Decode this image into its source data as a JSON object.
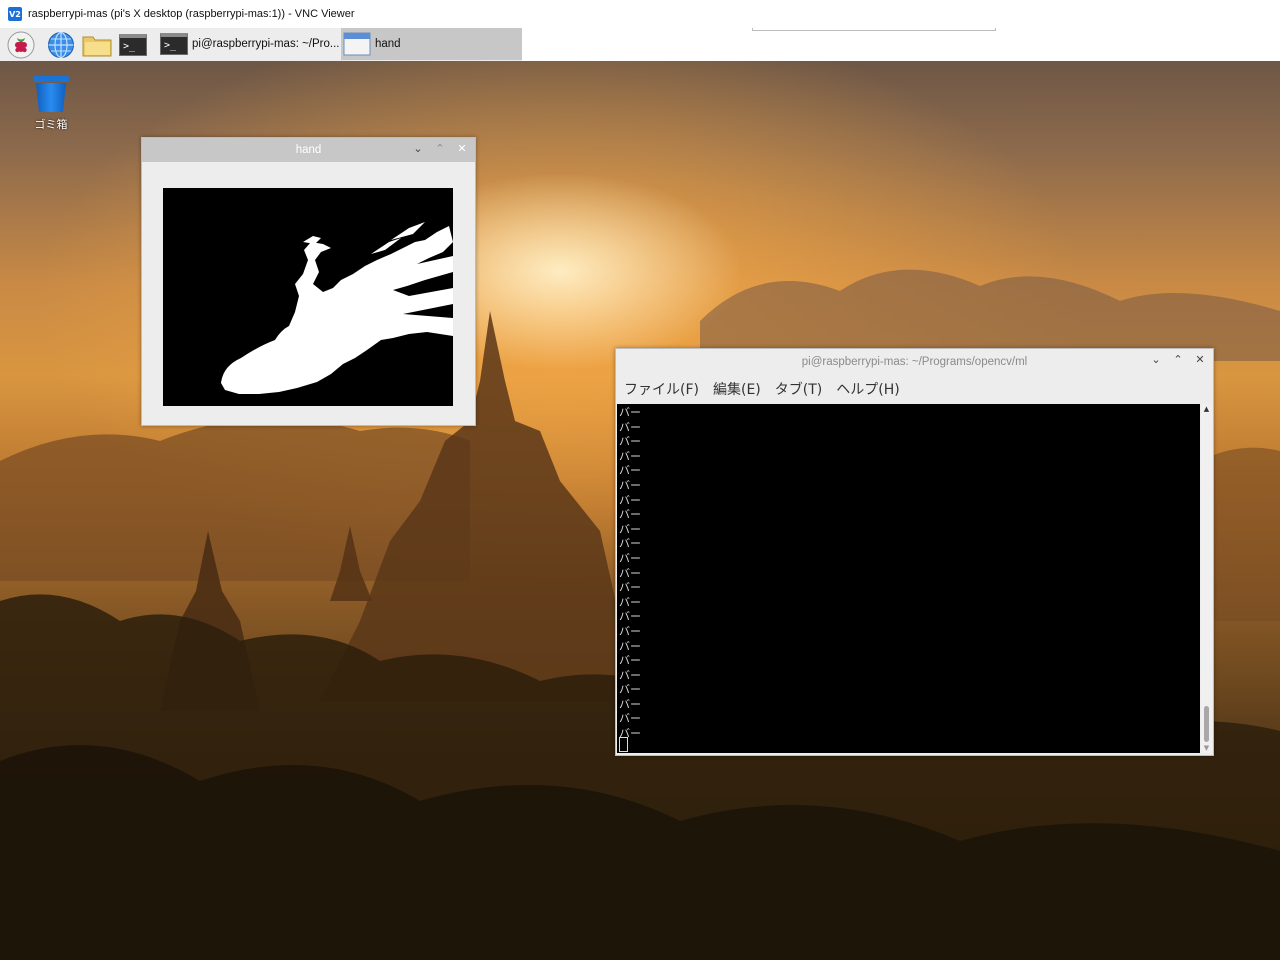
{
  "vnc": {
    "logo_text": "V2",
    "title": "raspberrypi-mas (pi's X desktop (raspberrypi-mas:1)) - VNC Viewer"
  },
  "taskbar": {
    "launchers": [
      {
        "name": "raspberry-menu-icon"
      },
      {
        "name": "web-browser-icon"
      },
      {
        "name": "file-manager-icon"
      },
      {
        "name": "terminal-launcher-icon",
        "glyph": ">_"
      }
    ],
    "tasks": [
      {
        "label": "pi@raspberrypi-mas: ~/Pro...",
        "glyph": ">_",
        "active": false
      },
      {
        "label": "hand",
        "active": true
      }
    ]
  },
  "desktop": {
    "trash_label": "ゴミ箱"
  },
  "hand_window": {
    "title": "hand",
    "controls": {
      "minimize": "⌄",
      "maximize": "⌃",
      "close": "✕"
    }
  },
  "terminal": {
    "title": "pi@raspberrypi-mas: ~/Programs/opencv/ml",
    "menu": [
      "ファイル(F)",
      "編集(E)",
      "タブ(T)",
      "ヘルプ(H)"
    ],
    "controls": {
      "minimize": "⌄",
      "maximize": "⌃",
      "close": "✕"
    },
    "lines": [
      "バー",
      "バー",
      "バー",
      "バー",
      "バー",
      "バー",
      "バー",
      "バー",
      "バー",
      "バー",
      "バー",
      "バー",
      "バー",
      "バー",
      "バー",
      "バー",
      "バー",
      "バー",
      "バー",
      "バー",
      "バー",
      "バー",
      "バー"
    ],
    "scroll_up": "▲",
    "scroll_down": "▼"
  }
}
